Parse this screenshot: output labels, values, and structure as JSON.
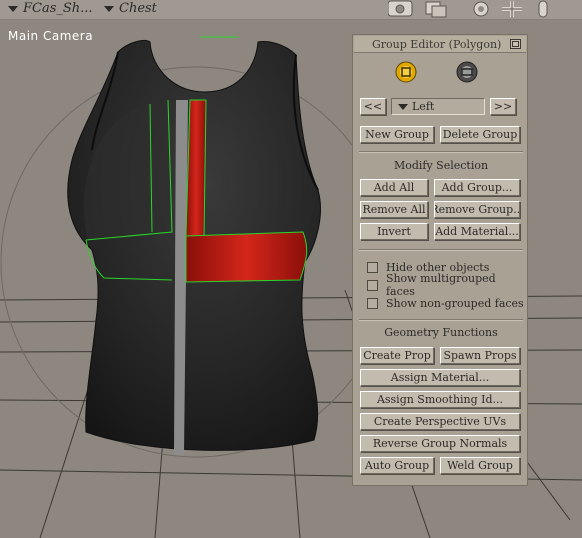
{
  "topbar": {
    "figure_menu": "FCas_Sh...",
    "part_menu": "Chest",
    "icons": [
      "camera-icon",
      "layers-icon",
      "rotate-icon",
      "move-icon",
      "scale-icon"
    ]
  },
  "viewport": {
    "camera_label": "Main Camera"
  },
  "panel": {
    "title": "Group Editor  (Polygon)",
    "prev_label": "<<",
    "next_label": ">>",
    "group_select": "Left",
    "new_group": "New Group",
    "delete_group": "Delete Group",
    "modify_title": "Modify Selection",
    "add_all": "Add All",
    "add_group": "Add Group...",
    "remove_all": "Remove All",
    "remove_group": "Remove Group...",
    "invert": "Invert",
    "add_material": "Add Material...",
    "hide_other": "Hide other objects",
    "show_multi": "Show multigrouped faces",
    "show_non": "Show non-grouped faces",
    "geometry_title": "Geometry Functions",
    "create_prop": "Create Prop",
    "spawn_props": "Spawn Props",
    "assign_material": "Assign Material...",
    "assign_smoothing": "Assign Smoothing Id...",
    "create_uvs": "Create Perspective UVs",
    "reverse_normals": "Reverse Group Normals",
    "auto_group": "Auto Group",
    "weld_group": "Weld Group"
  },
  "colors": {
    "viewport_bg": "#8d877f",
    "panel_bg": "#a9a194",
    "garment": "#242424",
    "selected_group": "#c01b12",
    "group_outline": "#2ad62a"
  }
}
